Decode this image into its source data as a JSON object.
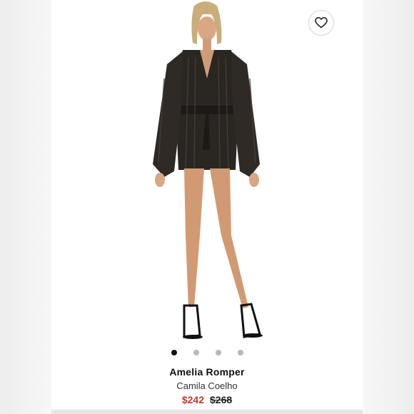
{
  "product": {
    "name": "Amelia Romper",
    "brand": "Camila Coelho",
    "sale_price": "$242",
    "original_price": "$268"
  },
  "gallery": {
    "image_count": 4,
    "active_index": 0
  },
  "icons": {
    "wishlist": "heart-outline-icon"
  },
  "colors": {
    "sale_price": "#c0392b",
    "active_dot": "#111111",
    "inactive_dot": "#b8b8b8"
  }
}
